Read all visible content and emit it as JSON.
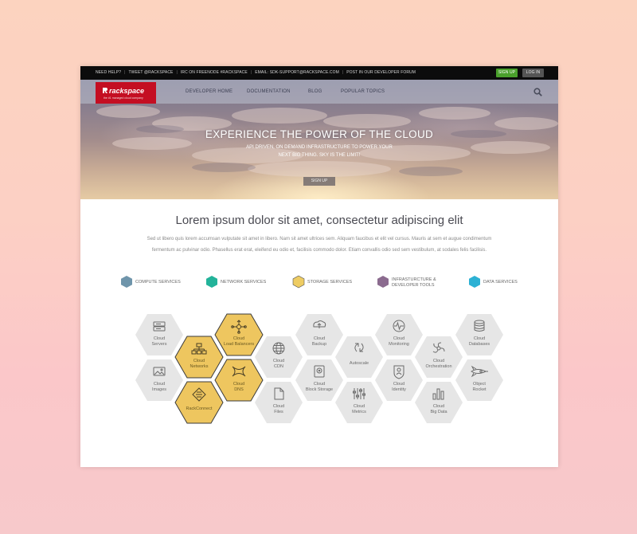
{
  "topbar": {
    "links": [
      "NEED HELP?",
      "TWEET @RACKSPACE",
      "IRC ON FREENODE #RACKSPACE",
      "EMAIL: SDK-SUPPORT@RACKSPACE.COM",
      "POST IN OUR DEVELOPER FORUM"
    ],
    "signup_label": "SIGN UP",
    "login_label": "LOG IN"
  },
  "logo": {
    "brand": "rackspace",
    "tagline": "the #1 managed cloud company"
  },
  "nav": {
    "items": [
      "DEVELOPER HOME",
      "DOCUMENTATION",
      "BLOG",
      "POPULAR TOPICS"
    ]
  },
  "hero": {
    "title": "EXPERIENCE THE POWER OF THE CLOUD",
    "subtitle": "API DRIVEN, ON DEMAND INFRASTRUCTURE TO POWER YOUR NEXT BIG THING. SKY IS THE LIMIT!",
    "button_label": "SIGN UP"
  },
  "intro": {
    "headline": "Lorem ipsum dolor sit amet, consectetur adipiscing elit",
    "body": "Sed ut libero quis lorem accumsan vulputate sit amet in libero. Nam sit amet ultrices sem. Aliquam faucibus et elit vel cursus. Mauris at sem et augue condimentum fermentum ac pulvinar odio. Phasellus erat erat, eleifend eu odio et, facilisis commodo dolor. Etiam convallis odio sed sem vestibulum, at sodales felis facilisis."
  },
  "legend": [
    {
      "label": "COMPUTE SERVICES",
      "color": "#6f95ab"
    },
    {
      "label": "NETWORK SERVICES",
      "color": "#23b39a"
    },
    {
      "label": "STORAGE SERVICES",
      "color": "#eecc63"
    },
    {
      "label": "INFRASTURCTURE & DEVELOPER TOOLS",
      "color": "#8b6b8f"
    },
    {
      "label": "DATA SERVICES",
      "color": "#2db1d4"
    }
  ],
  "services": [
    {
      "label": "Cloud Servers",
      "icon": "server-icon",
      "highlight": false
    },
    {
      "label": "Cloud Images",
      "icon": "image-icon",
      "highlight": false
    },
    {
      "label": "Cloud Networks",
      "icon": "network-icon",
      "highlight": true
    },
    {
      "label": "RackConnect",
      "icon": "rackconnect-icon",
      "highlight": true
    },
    {
      "label": "Cloud Load Balancers",
      "icon": "load-balancer-icon",
      "highlight": true
    },
    {
      "label": "Cloud DNS",
      "icon": "dns-icon",
      "highlight": true
    },
    {
      "label": "Cloud CDN",
      "icon": "globe-icon",
      "highlight": false
    },
    {
      "label": "Cloud Files",
      "icon": "file-icon",
      "highlight": false
    },
    {
      "label": "Cloud Backup",
      "icon": "backup-icon",
      "highlight": false
    },
    {
      "label": "Cloud Block Storage",
      "icon": "block-storage-icon",
      "highlight": false
    },
    {
      "label": "Autoscale",
      "icon": "autoscale-icon",
      "highlight": false
    },
    {
      "label": "Cloud Metrics",
      "icon": "metrics-icon",
      "highlight": false
    },
    {
      "label": "Cloud Monitoring",
      "icon": "monitoring-icon",
      "highlight": false
    },
    {
      "label": "Cloud Identity",
      "icon": "identity-icon",
      "highlight": false
    },
    {
      "label": "Cloud Orchestration",
      "icon": "orchestration-icon",
      "highlight": false
    },
    {
      "label": "Cloud Big Data",
      "icon": "big-data-icon",
      "highlight": false
    },
    {
      "label": "Cloud Databases",
      "icon": "database-icon",
      "highlight": false
    },
    {
      "label": "Object Rocket",
      "icon": "rocket-icon",
      "highlight": false
    }
  ],
  "colors": {
    "hex_default": "#e6e6e6",
    "hex_highlight": "#eec65f",
    "accent_green": "#4aa02c",
    "brand_red": "#c40e22"
  }
}
